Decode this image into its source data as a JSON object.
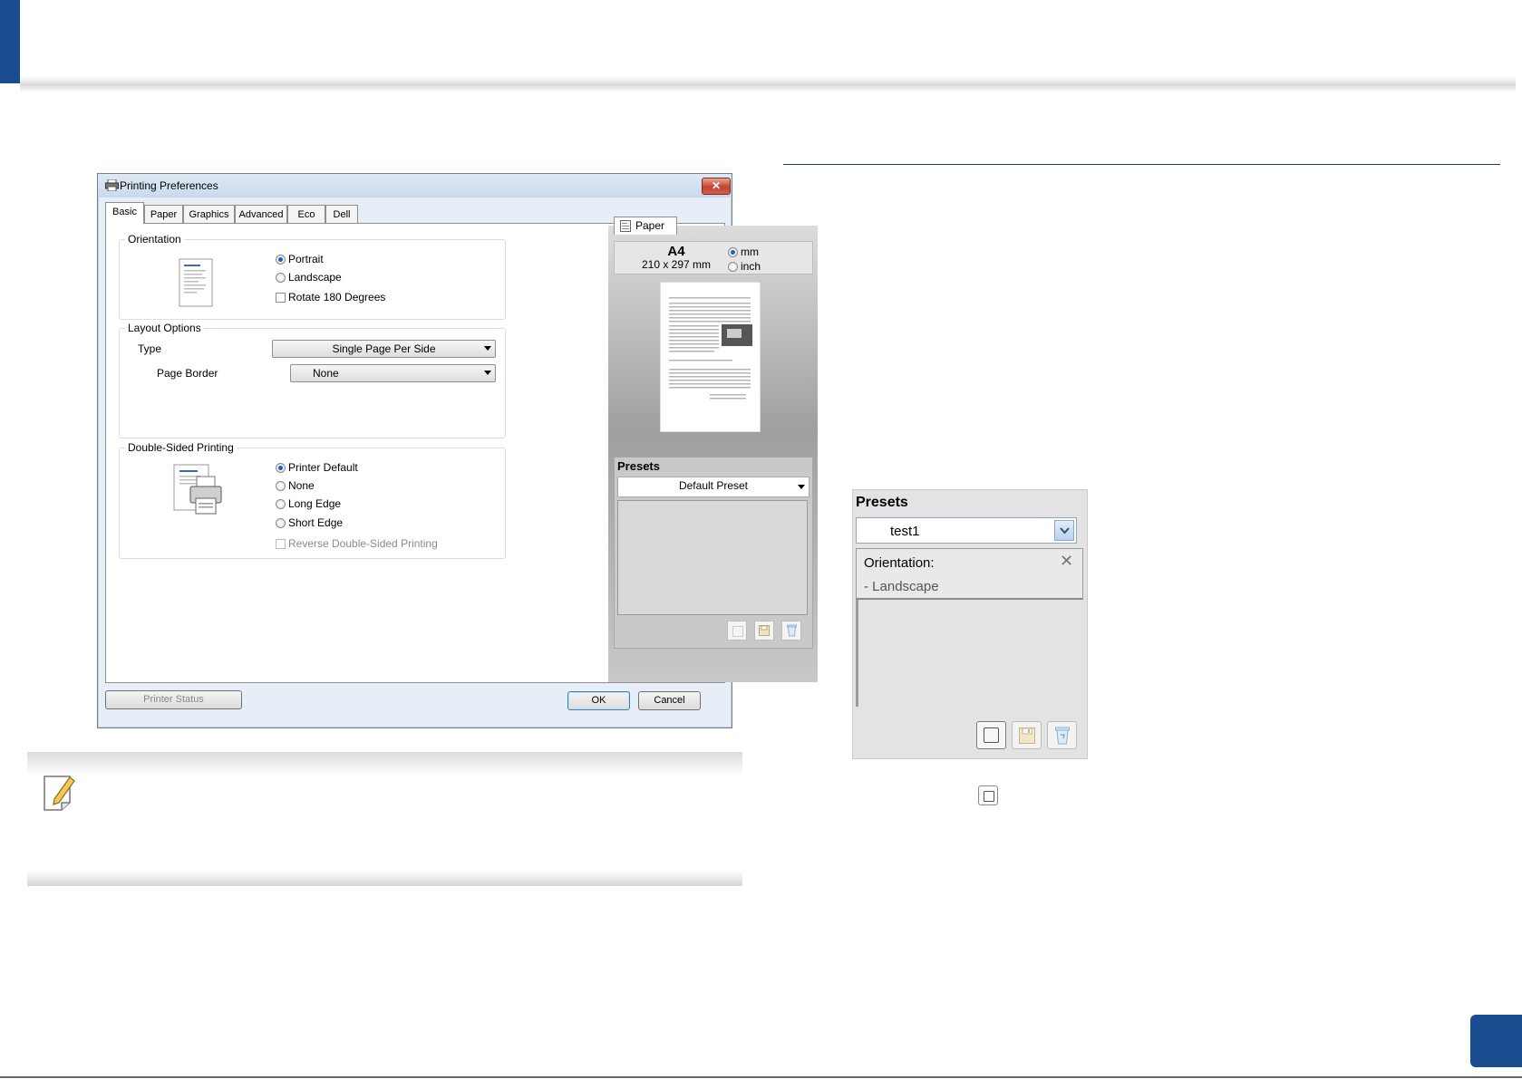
{
  "dialog": {
    "title": "Printing Preferences",
    "close_label": "✕",
    "tabs": [
      {
        "label": "Basic"
      },
      {
        "label": "Paper"
      },
      {
        "label": "Graphics"
      },
      {
        "label": "Advanced"
      },
      {
        "label": "Eco"
      },
      {
        "label": "Dell"
      }
    ],
    "orientation": {
      "label": "Orientation",
      "options": [
        "Portrait",
        "Landscape"
      ],
      "selected": "Portrait",
      "rotate_label": "Rotate 180 Degrees"
    },
    "layout": {
      "label": "Layout Options",
      "type_label": "Type",
      "type_value": "Single Page Per Side",
      "border_label": "Page Border",
      "border_value": "None"
    },
    "duplex": {
      "label": "Double-Sided Printing",
      "options": [
        "Printer Default",
        "None",
        "Long Edge",
        "Short Edge"
      ],
      "selected": "Printer Default",
      "reverse_label": "Reverse Double-Sided Printing"
    },
    "paper": {
      "tab_label": "Paper",
      "size_name": "A4",
      "size_dims": "210 x 297 mm",
      "unit_options": [
        "mm",
        "inch"
      ],
      "unit_selected": "mm"
    },
    "presets": {
      "label": "Presets",
      "value": "Default Preset"
    },
    "buttons": {
      "printer_status": "Printer Status",
      "ok": "OK",
      "cancel": "Cancel"
    }
  },
  "presets_zoom": {
    "label": "Presets",
    "value": "test1",
    "item_title": "Orientation:",
    "item_value": "- Landscape",
    "remove_label": "✕"
  },
  "colors": {
    "accent": "#1a4d8f",
    "dialog_bg": "#e8eef7",
    "radio_selected": "#1f5fbf"
  }
}
